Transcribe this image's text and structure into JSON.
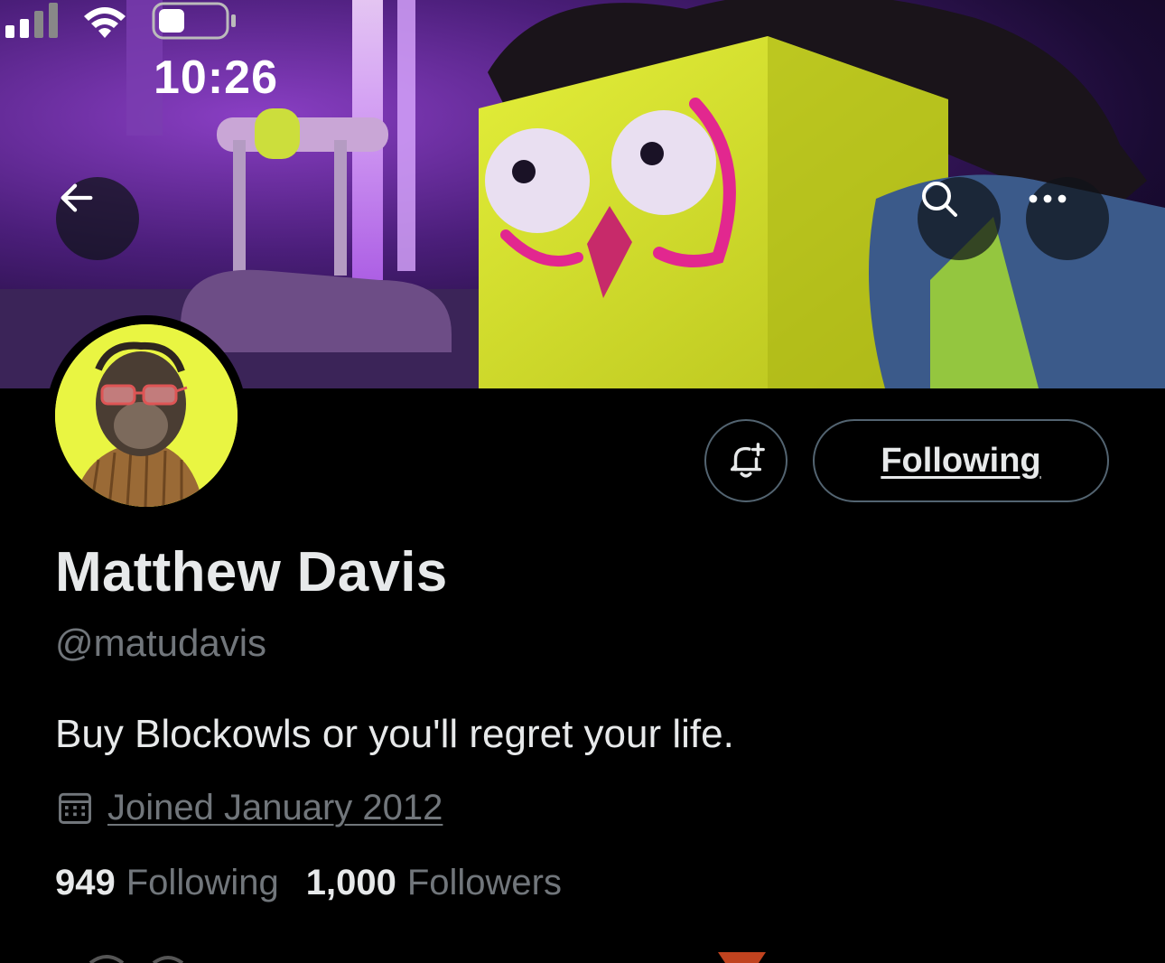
{
  "status_bar": {
    "time": "10:26",
    "signal_icon": "cellular-signal-icon",
    "wifi_icon": "wifi-icon",
    "battery_icon": "battery-icon"
  },
  "header": {
    "back_icon": "arrow-left-icon",
    "search_icon": "search-icon",
    "more_icon": "more-horizontal-icon"
  },
  "profile": {
    "display_name": "Matthew Davis",
    "handle": "@matudavis",
    "bio": "Buy Blockowls or you'll regret your life.",
    "joined": "Joined January 2012",
    "following_count": "949",
    "following_label": "Following",
    "followers_count": "1,000",
    "followers_label": "Followers"
  },
  "actions": {
    "notify_icon": "bell-plus-icon",
    "following_button_label": "Following"
  },
  "colors": {
    "background": "#000000",
    "primary_text": "#e7e9ea",
    "secondary_text": "#71767b",
    "button_border": "#536471",
    "avatar_background": "#e9f542"
  }
}
